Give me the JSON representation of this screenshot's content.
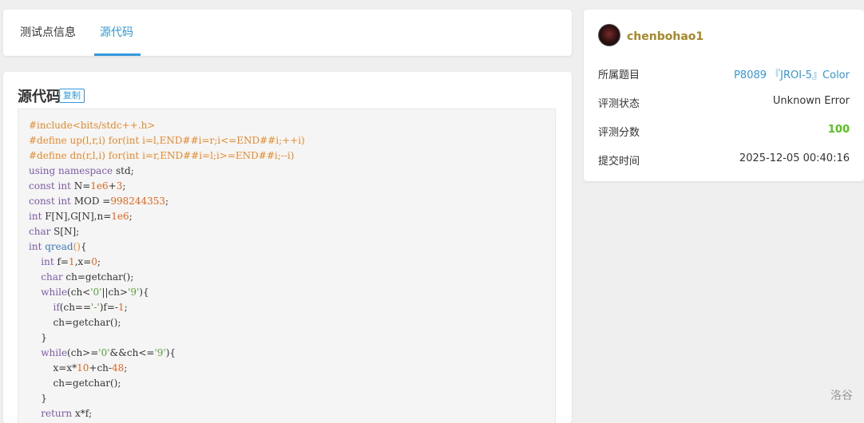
{
  "tabs": [
    {
      "label": "测试点信息"
    },
    {
      "label": "源代码"
    }
  ],
  "code_section": {
    "title": "源代码",
    "copy_label": "复制"
  },
  "code_lines": [
    [
      {
        "t": "#include<bits/stdc++.h>",
        "c": "pp"
      }
    ],
    [
      {
        "t": "#define up(l,r,i) for(int i=l,END##i=r;i<=END##i;++i)",
        "c": "pp"
      }
    ],
    [
      {
        "t": "#define dn(r,l,i) for(int i=r,END##i=l;i>=END##i;--i)",
        "c": "pp"
      }
    ],
    [
      {
        "t": "using",
        "c": "kw"
      },
      {
        "t": " "
      },
      {
        "t": "namespace",
        "c": "kw"
      },
      {
        "t": " std;"
      }
    ],
    [
      {
        "t": "const",
        "c": "kw"
      },
      {
        "t": " "
      },
      {
        "t": "int",
        "c": "kw"
      },
      {
        "t": " N="
      },
      {
        "t": "1e6",
        "c": "num"
      },
      {
        "t": "+"
      },
      {
        "t": "3",
        "c": "num"
      },
      {
        "t": ";"
      }
    ],
    [
      {
        "t": "const",
        "c": "kw"
      },
      {
        "t": " "
      },
      {
        "t": "int",
        "c": "kw"
      },
      {
        "t": " MOD ="
      },
      {
        "t": "998244353",
        "c": "num"
      },
      {
        "t": ";"
      }
    ],
    [
      {
        "t": "int",
        "c": "kw"
      },
      {
        "t": " F[N],G[N],n="
      },
      {
        "t": "1e6",
        "c": "num"
      },
      {
        "t": ";"
      }
    ],
    [
      {
        "t": "char",
        "c": "kw"
      },
      {
        "t": " S[N];"
      }
    ],
    [
      {
        "t": "int",
        "c": "kw"
      },
      {
        "t": " "
      },
      {
        "t": "qread",
        "c": "fn"
      },
      {
        "t": "()",
        "c": "pp"
      },
      {
        "t": "{"
      }
    ],
    [
      {
        "t": "    "
      },
      {
        "t": "int",
        "c": "kw"
      },
      {
        "t": " f="
      },
      {
        "t": "1",
        "c": "num"
      },
      {
        "t": ",x="
      },
      {
        "t": "0",
        "c": "num"
      },
      {
        "t": ";"
      }
    ],
    [
      {
        "t": "    "
      },
      {
        "t": "char",
        "c": "kw"
      },
      {
        "t": " ch=getchar();"
      }
    ],
    [
      {
        "t": "    "
      },
      {
        "t": "while",
        "c": "kw"
      },
      {
        "t": "(ch<"
      },
      {
        "t": "'0'",
        "c": "str"
      },
      {
        "t": "||ch>"
      },
      {
        "t": "'9'",
        "c": "str"
      },
      {
        "t": "){"
      }
    ],
    [
      {
        "t": "        "
      },
      {
        "t": "if",
        "c": "kw"
      },
      {
        "t": "(ch=="
      },
      {
        "t": "'-'",
        "c": "str"
      },
      {
        "t": ")f=-"
      },
      {
        "t": "1",
        "c": "num"
      },
      {
        "t": ";"
      }
    ],
    [
      {
        "t": "        ch=getchar();"
      }
    ],
    [
      {
        "t": "    }"
      }
    ],
    [
      {
        "t": "    "
      },
      {
        "t": "while",
        "c": "kw"
      },
      {
        "t": "(ch>="
      },
      {
        "t": "'0'",
        "c": "str"
      },
      {
        "t": "&&ch<="
      },
      {
        "t": "'9'",
        "c": "str"
      },
      {
        "t": "){"
      }
    ],
    [
      {
        "t": "        x=x*"
      },
      {
        "t": "10",
        "c": "num"
      },
      {
        "t": "+ch-"
      },
      {
        "t": "48",
        "c": "num"
      },
      {
        "t": ";"
      }
    ],
    [
      {
        "t": "        ch=getchar();"
      }
    ],
    [
      {
        "t": "    }"
      }
    ],
    [
      {
        "t": "    "
      },
      {
        "t": "return",
        "c": "kw"
      },
      {
        "t": " x*f;"
      }
    ]
  ],
  "sidebar": {
    "username": "chenbohao1",
    "rows": [
      {
        "label": "所属题目",
        "value": "P8089 『JROI-5』Color"
      },
      {
        "label": "评测状态",
        "value": "Unknown Error"
      },
      {
        "label": "评测分数",
        "value": "100"
      },
      {
        "label": "提交时间",
        "value": "2025-12-05 00:40:16"
      }
    ]
  },
  "watermark": "洛谷",
  "colors": {
    "accent": "#3498db",
    "username": "#a6882a",
    "score": "#52c41a"
  }
}
